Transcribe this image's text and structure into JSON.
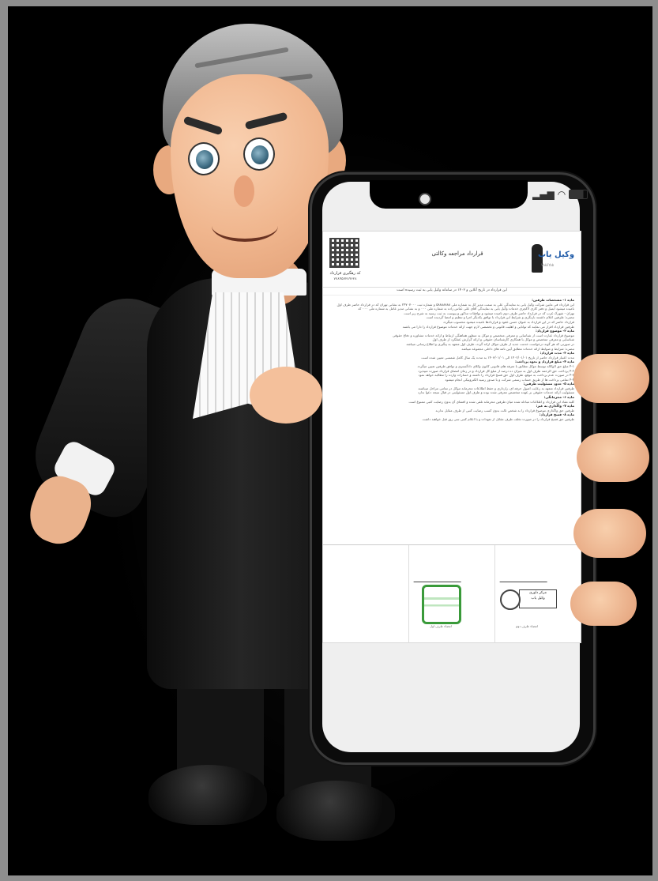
{
  "scene": {
    "description_subject": "lawyer-mascot-holding-smartphone"
  },
  "phone": {
    "status_time": "",
    "document": {
      "qr_label": "کد رهگیری قرارداد",
      "qr_code": "۷۷۸۹۵۷۲۸۹۶۲۸",
      "title": "قرارداد مراجعه وکالتی",
      "logo_text": "وکیل یاب",
      "logo_sub": "VakilYab",
      "notice": "این قرارداد در تاریخ آنلاین و ۱۴۰۲ در سامانه وکیل یابی به ثبت رسیده است",
      "lines": [
        {
          "text": "ماده ۱- مشخصات طرفین:",
          "heading": true
        },
        {
          "text": "این قرارداد فی مابین شرکت وکیل یابی به نمایندگی علی به سمت مدیر کل به شماره ملی ۵۸۸۸۸۸۸۸ و شماره ثبت ۲۴۷۰۷۰۰۰ به نشانی تهران که در قرارداد حاضر طرف اول",
          "heading": false
        },
        {
          "text": "نامیده میشود ایمیل و دفتر کاری لاکچری خدمات وکیل یابی به نمایندگی آقای علی عباس زاده به شماره ملی ۰۰۰ و به نشانی مدیر عامل به شماره ملی ۰۰۰ که",
          "heading": false
        },
        {
          "text": "تهران - شهرک غرب که در قرارداد حاضر طرف دوم نامیده میشود و توافقات مذکور و پیوست به ثبت رسید به شرح زیر است",
          "heading": false
        },
        {
          "text": "تبصره: طرفین اعلام داشتند بازنگری و شرایط این قرارداد با توافق یکدیگر اجرا و تنظیم و امضا گردیده است",
          "heading": false
        },
        {
          "text": "قرارداد حاضر که در این قرارداد به عنوان حسن عقود و قراردادها نامیده میشود محسوب میگردد",
          "heading": false
        },
        {
          "text": "طرفین قرارداد اقرار می نمایند که توانایی و اهلیت قانونی و تخصصی لازم جهت ارائه خدمات موضوع قرارداد را دارا می باشند",
          "heading": false
        },
        {
          "text": "ماده ۲- موضوع قرارداد:",
          "heading": true
        },
        {
          "text": "موضوع قرارداد عبارت است از شناسایی و معرفی متخصص و موکل به منظور هماهنگی ارتباط و ارائه خدمات مشاوره و دفاع حقوقی",
          "heading": false
        },
        {
          "text": "شناسایی و معرفی متخصص و موکل با همکاری کارشناسان حقوقی و ارائه گزارش عملکرد از طرف اول",
          "heading": false
        },
        {
          "text": "در صورتی که هر گونه درخواست خدمت جدید از طرف موکل ارائه گردد، طرف اول متعهد به پیگیری و اطلاع رسانی میباشد",
          "heading": false
        },
        {
          "text": "تبصره: شرایط و ضوابط ارائه خدمات مطابق آیین نامه های داخلی مجموعه میباشد",
          "heading": false
        },
        {
          "text": "ماده ۳- مدت قرارداد:",
          "heading": true
        },
        {
          "text": "مدت اعتبار قرارداد حاضر از تاریخ ۱۴۰۲/۰۱/۰۱ الی ۱۴۰۳/۰۱/۰۱ به مدت یک سال کامل شمسی تعیین شده است",
          "heading": false
        },
        {
          "text": "ماده ۴- مبلغ قرارداد و نحوه پرداخت:",
          "heading": true
        },
        {
          "text": "۴-۱ مبلغ حق الوکاله توسط موکل مطابق با تعرفه های قانونی کانون وکلای دادگستری و توافق طرفین تعیین میگردد",
          "heading": false
        },
        {
          "text": "۴-۲ پرداخت حق الزحمه طرف اول به میزان ده درصد از مبلغ کل قرارداد و در زمان امضای قرارداد صورت میپذیرد",
          "heading": false
        },
        {
          "text": "۴-۳ در صورت عدم پرداخت به موقع، طرف اول حق فسخ قرارداد را داشته و خسارات وارده را مطالبه خواهد نمود",
          "heading": false
        },
        {
          "text": "۴-۴ تمامی پرداخت ها از طریق حساب رسمی شرکت و با صدور رسید الکترونیکی انجام میشود",
          "heading": false
        },
        {
          "text": "ماده ۵- حدود مسئولیت طرفین:",
          "heading": true
        },
        {
          "text": "طرفین قرارداد متعهد به رعایت اصول حرفه ای، رازداری و حفظ اطلاعات محرمانه موکل در تمامی مراحل میباشند",
          "heading": false
        },
        {
          "text": "مسئولیت ارائه خدمات حقوقی بر عهده متخصص معرفی شده بوده و طرف اول مسئولیتی در قبال نتیجه دعوا ندارد",
          "heading": false
        },
        {
          "text": "ماده ۶- محرمانگی:",
          "heading": true
        },
        {
          "text": "کلیه مفاد این قرارداد و اطلاعات مبادله شده میان طرفین محرمانه تلقی شده و افشای آن بدون رضایت کتبی ممنوع است",
          "heading": false
        },
        {
          "text": "ماده ۷- واگذاری به غیر:",
          "heading": true
        },
        {
          "text": "طرفین حق واگذاری موضوع قرارداد را به شخص ثالث بدون کسب رضایت کتبی از طرف مقابل ندارند",
          "heading": false
        },
        {
          "text": "ماده ۸- فسخ قرارداد:",
          "heading": true
        },
        {
          "text": "طرفین حق فسخ قرارداد را در صورت تخلف طرف مقابل از تعهدات و با اعلام کتبی سی روز قبل خواهند داشت",
          "heading": false
        }
      ],
      "stamp_name": "مرکز داوری",
      "stamp_sub": "وکیل یاب",
      "sign_caption_right": "امضاء طرف دوم",
      "sign_caption_left": "امضاء طرف اول"
    }
  },
  "colors": {
    "background": "#000000",
    "border": "#8e8e8e",
    "logo_blue": "#1e5aa8",
    "stamp_green": "#3a9a3a"
  }
}
